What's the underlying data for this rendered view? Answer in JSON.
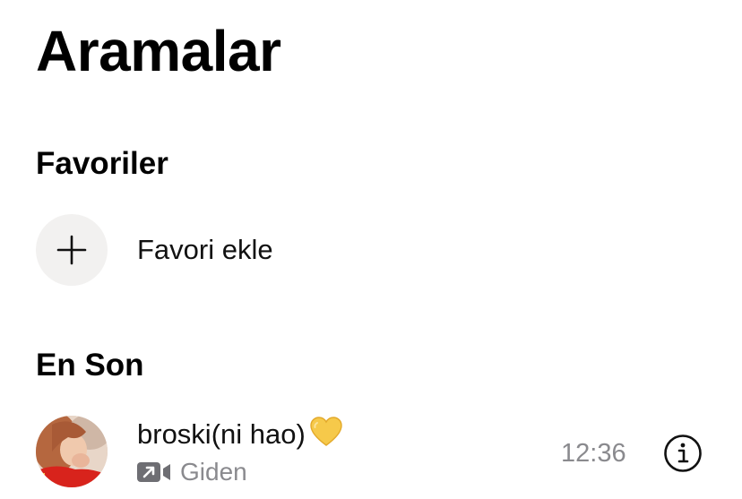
{
  "header": {
    "title": "Aramalar"
  },
  "favorites": {
    "heading": "Favoriler",
    "add_label": "Favori ekle",
    "add_icon": "plus-icon"
  },
  "recent": {
    "heading": "En Son",
    "calls": [
      {
        "name": "broski(ni hao)",
        "emoji": "yellow-heart",
        "call_type_icon": "outgoing-video-call-icon",
        "direction": "Giden",
        "time": "12:36",
        "action_icon": "info-icon"
      }
    ]
  },
  "colors": {
    "background": "#ffffff",
    "text_primary": "#111111",
    "text_secondary": "#8a8a8e",
    "add_circle_bg": "#f2f1f0",
    "heart": "#f6c94a"
  }
}
